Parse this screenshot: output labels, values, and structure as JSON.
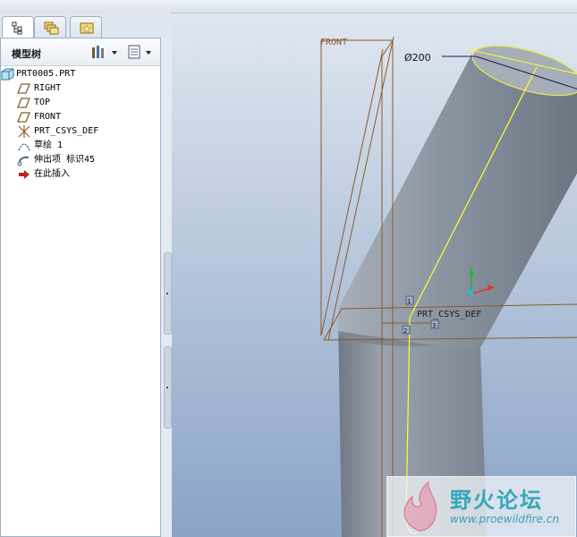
{
  "panel": {
    "title": "模型树"
  },
  "tabs": [
    {
      "name": "model-tree-tab",
      "icon": "tree-icon",
      "active": true
    },
    {
      "name": "folder-browser-tab",
      "icon": "folders-icon",
      "active": false
    },
    {
      "name": "favorites-tab",
      "icon": "star-folder-icon",
      "active": false
    }
  ],
  "tree": {
    "items": [
      {
        "label": "PRT0005.PRT",
        "icon": "part-icon"
      },
      {
        "label": "RIGHT",
        "icon": "datum-plane-icon"
      },
      {
        "label": "TOP",
        "icon": "datum-plane-icon"
      },
      {
        "label": "FRONT",
        "icon": "datum-plane-icon"
      },
      {
        "label": "PRT_CSYS_DEF",
        "icon": "coordinate-system-icon"
      },
      {
        "label": "草绘 1",
        "icon": "sketch-icon"
      },
      {
        "label": "伸出项 标识45",
        "icon": "extrude-icon"
      },
      {
        "label": "在此插入",
        "icon": "insert-arrow-icon"
      }
    ]
  },
  "viewport": {
    "front_label": "FRONT",
    "dimension_label": "Ø200",
    "csys_label": "PRT_CSYS_DEF",
    "marker_labels": [
      "1",
      "2",
      "3"
    ],
    "colors": {
      "edge_highlight": "#ffff33",
      "datum": "#8b5a2b",
      "body": "#8e98a4"
    }
  },
  "watermark": {
    "title": "野火论坛",
    "url": "www.proewildfire.cn"
  }
}
